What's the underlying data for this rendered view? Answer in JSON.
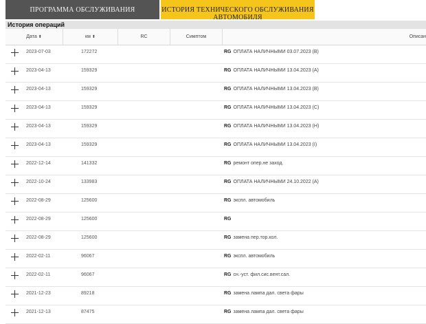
{
  "tabs": [
    {
      "label": "ПРОГРАММА ОБСЛУЖИВАНИЯ"
    },
    {
      "label": "ИСТОРИЯ ТЕХНИЧЕСКОГО ОБСЛУЖИВАНИЯ АВТОМОБИЛЯ"
    }
  ],
  "section_title": "История операций",
  "columns": {
    "date": "Дата",
    "km": "км",
    "rc": "RC",
    "symptom": "Симптом",
    "description": "Описан"
  },
  "sort_icon": "sort-icon",
  "rows": [
    {
      "date": "2023-07-03",
      "km": "172272",
      "tag": "RG",
      "desc": "ОПЛАТА НАЛИЧНЫМИ 03.07.2023 (B)"
    },
    {
      "date": "2023-04-13",
      "km": "159329",
      "tag": "RG",
      "desc": "ОПЛАТА НАЛИЧНЫМИ 13.04.2023 (A)"
    },
    {
      "date": "2023-04-13",
      "km": "159329",
      "tag": "RG",
      "desc": "ОПЛАТА НАЛИЧНЫМИ 13.04.2023 (B)"
    },
    {
      "date": "2023-04-13",
      "km": "159329",
      "tag": "RG",
      "desc": "ОПЛАТА НАЛИЧНЫМИ 13.04.2023 (C)"
    },
    {
      "date": "2023-04-13",
      "km": "159329",
      "tag": "RG",
      "desc": "ОПЛАТА НАЛИЧНЫМИ 13.04.2023 (H)"
    },
    {
      "date": "2023-04-13",
      "km": "159329",
      "tag": "RG",
      "desc": "ОПЛАТА НАЛИЧНЫМИ 13.04.2023 (I)"
    },
    {
      "date": "2022-12-14",
      "km": "141332",
      "tag": "RG",
      "desc": "ремонт опер.не заход."
    },
    {
      "date": "2022-10-24",
      "km": "133983",
      "tag": "RG",
      "desc": "ОПЛАТА НАЛИЧНЫМИ 24.10.2022 (A)"
    },
    {
      "date": "2022-08-29",
      "km": "125600",
      "tag": "RG",
      "desc": "экспл. автомобиль"
    },
    {
      "date": "2022-08-29",
      "km": "125600",
      "tag": "RG",
      "desc": ""
    },
    {
      "date": "2022-08-29",
      "km": "125600",
      "tag": "RG",
      "desc": "замена пер.тор.кол."
    },
    {
      "date": "2022-02-11",
      "km": "96067",
      "tag": "RG",
      "desc": "экспл. автомобиль"
    },
    {
      "date": "2022-02-11",
      "km": "96067",
      "tag": "RG",
      "desc": "сн.-уст. фил.сис.вент.сал."
    },
    {
      "date": "2021-12-23",
      "km": "89218",
      "tag": "RG",
      "desc": "замена лампа дал. света фары"
    },
    {
      "date": "2021-12-13",
      "km": "87475",
      "tag": "RG",
      "desc": "замена лампа дал. света фары"
    }
  ]
}
